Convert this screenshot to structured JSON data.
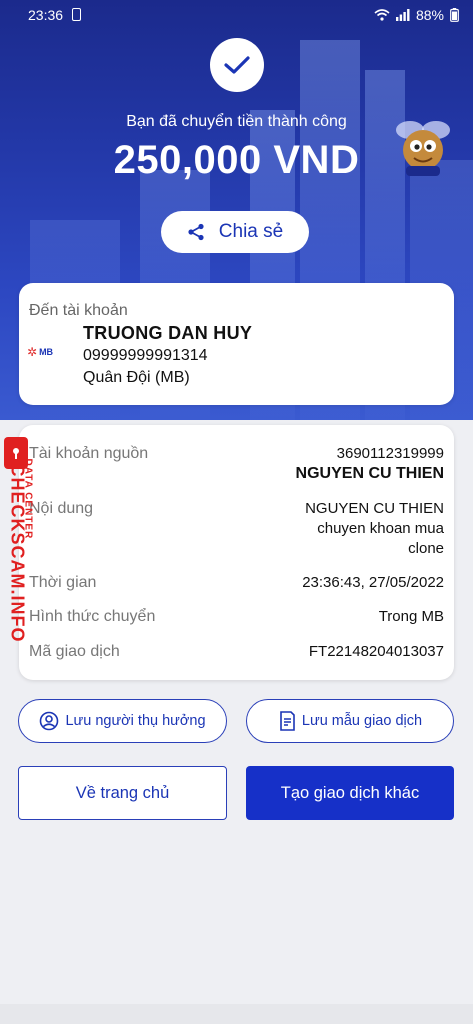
{
  "status_bar": {
    "time": "23:36",
    "battery": "88%"
  },
  "hero": {
    "success_message": "Bạn đã chuyển tiền thành công",
    "amount": "250,000 VND",
    "share_label": "Chia sẻ"
  },
  "recipient": {
    "label": "Đến tài khoản",
    "bank_logo_text": "MB",
    "name": "TRUONG DAN HUY",
    "account_number": "09999999991314",
    "bank_name": "Quân Đội (MB)"
  },
  "details": {
    "source_label": "Tài khoản nguồn",
    "source_account": "3690112319999",
    "source_name": "NGUYEN CU THIEN",
    "content_label": "Nội dung",
    "content_line1": "NGUYEN CU THIEN",
    "content_line2": "chuyen khoan mua",
    "content_line3": "clone",
    "time_label": "Thời gian",
    "time_value": "23:36:43, 27/05/2022",
    "method_label": "Hình thức chuyển",
    "method_value": "Trong MB",
    "txn_label": "Mã giao dịch",
    "txn_value": "FT22148204013037"
  },
  "actions": {
    "save_beneficiary": "Lưu người thụ hưởng",
    "save_template": "Lưu mẫu giao dịch",
    "home": "Về trang chủ",
    "new_transaction": "Tạo giao dịch khác"
  },
  "watermark": {
    "main": "CHECKSCAM.INFO",
    "sub": "DATA CENTER"
  },
  "colors": {
    "primary": "#1630c8",
    "hero_dark": "#1b2a8c",
    "watermark": "#e02020"
  }
}
